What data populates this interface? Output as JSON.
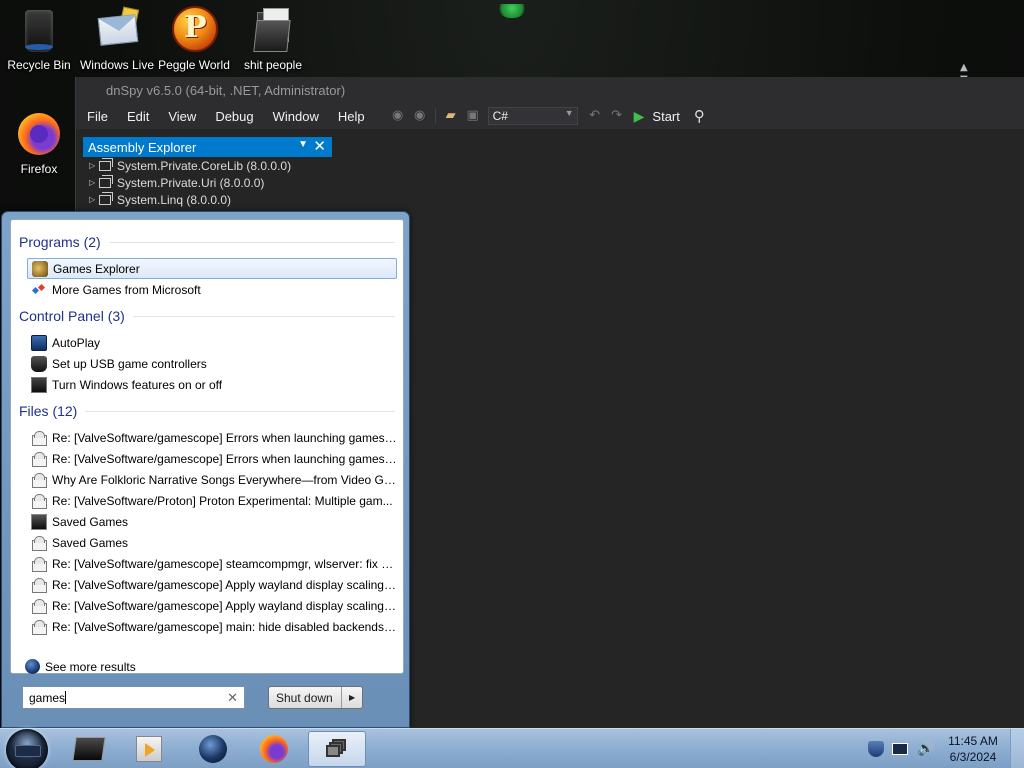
{
  "desktop": {
    "icons": [
      {
        "label": "Recycle Bin"
      },
      {
        "label": "Windows Live"
      },
      {
        "label": "Peggle World"
      },
      {
        "label": "shit people"
      },
      {
        "label": "Firefox"
      }
    ]
  },
  "dnspy": {
    "title": "dnSpy v6.5.0 (64-bit, .NET, Administrator)",
    "menu": [
      "File",
      "Edit",
      "View",
      "Debug",
      "Window",
      "Help"
    ],
    "language": "C#",
    "start_label": "Start",
    "assembly_explorer": {
      "title": "Assembly Explorer",
      "items": [
        "System.Private.CoreLib (8.0.0.0)",
        "System.Private.Uri (8.0.0.0)",
        "System.Linq (8.0.0.0)"
      ]
    }
  },
  "start_menu": {
    "groups": {
      "programs": "Programs (2)",
      "control_panel": "Control Panel (3)",
      "files": "Files (12)"
    },
    "programs": [
      "Games Explorer",
      "More Games from Microsoft"
    ],
    "control_panel": [
      "AutoPlay",
      "Set up USB game controllers",
      "Turn Windows features on or off"
    ],
    "files": [
      "Re: [ValveSoftware/gamescope] Errors when launching games ...",
      "Re: [ValveSoftware/gamescope] Errors when launching games ...",
      "Why Are Folkloric Narrative Songs Everywhere—from Video Ga...",
      "Re: [ValveSoftware/Proton] Proton Experimental: Multiple gam...",
      "Saved Games",
      "Saved Games",
      "Re: [ValveSoftware/gamescope] steamcompmgr, wlserver: fix b...",
      "Re: [ValveSoftware/gamescope] Apply wayland display scaling ...",
      "Re: [ValveSoftware/gamescope] Apply wayland display scaling ...",
      "Re: [ValveSoftware/gamescope] main: hide disabled backends f..."
    ],
    "see_more": "See more results",
    "search_value": "games",
    "shutdown_label": "Shut down"
  },
  "taskbar": {
    "time": "11:45 AM",
    "date": "6/3/2024"
  },
  "colors": {
    "accent": "#007acc",
    "group_header": "#1e3287",
    "taskbar": "#8fb0d3"
  }
}
